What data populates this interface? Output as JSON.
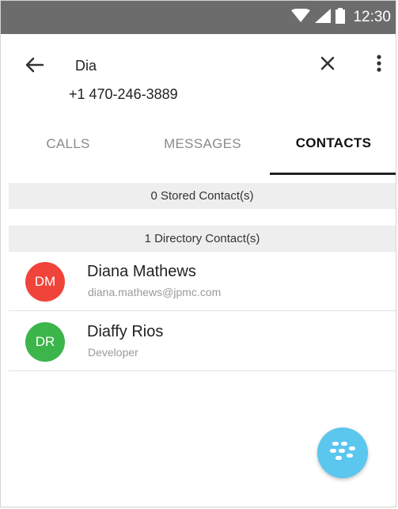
{
  "status_bar": {
    "time": "12:30",
    "icons": [
      "wifi-icon",
      "signal-icon",
      "battery-icon"
    ]
  },
  "header": {
    "query": "Dia",
    "phone": "+1 470-246-3889",
    "icons": {
      "back": "arrow-left-icon",
      "clear": "close-icon",
      "more": "more-vertical-icon"
    }
  },
  "tabs": [
    {
      "label": "CALLS",
      "active": false
    },
    {
      "label": "MESSAGES",
      "active": false
    },
    {
      "label": "CONTACTS",
      "active": true
    }
  ],
  "sections": {
    "stored": "0 Stored Contact(s)",
    "directory": "1 Directory Contact(s)"
  },
  "contacts": [
    {
      "initials": "DM",
      "name": "Diana Mathews",
      "subtitle": "diana.mathews@jpmc.com",
      "color": "#f0433a"
    },
    {
      "initials": "DR",
      "name": "Diaffy Rios",
      "subtitle": "Developer",
      "color": "#3cb54a"
    }
  ],
  "fab": {
    "icon": "blackberry-icon",
    "color": "#5bc6ee"
  },
  "colors": {
    "status_bar": "#6c6c6c",
    "section_header": "#eeeeee",
    "active_tab": "#111111",
    "inactive_tab": "#8a8a8a"
  }
}
